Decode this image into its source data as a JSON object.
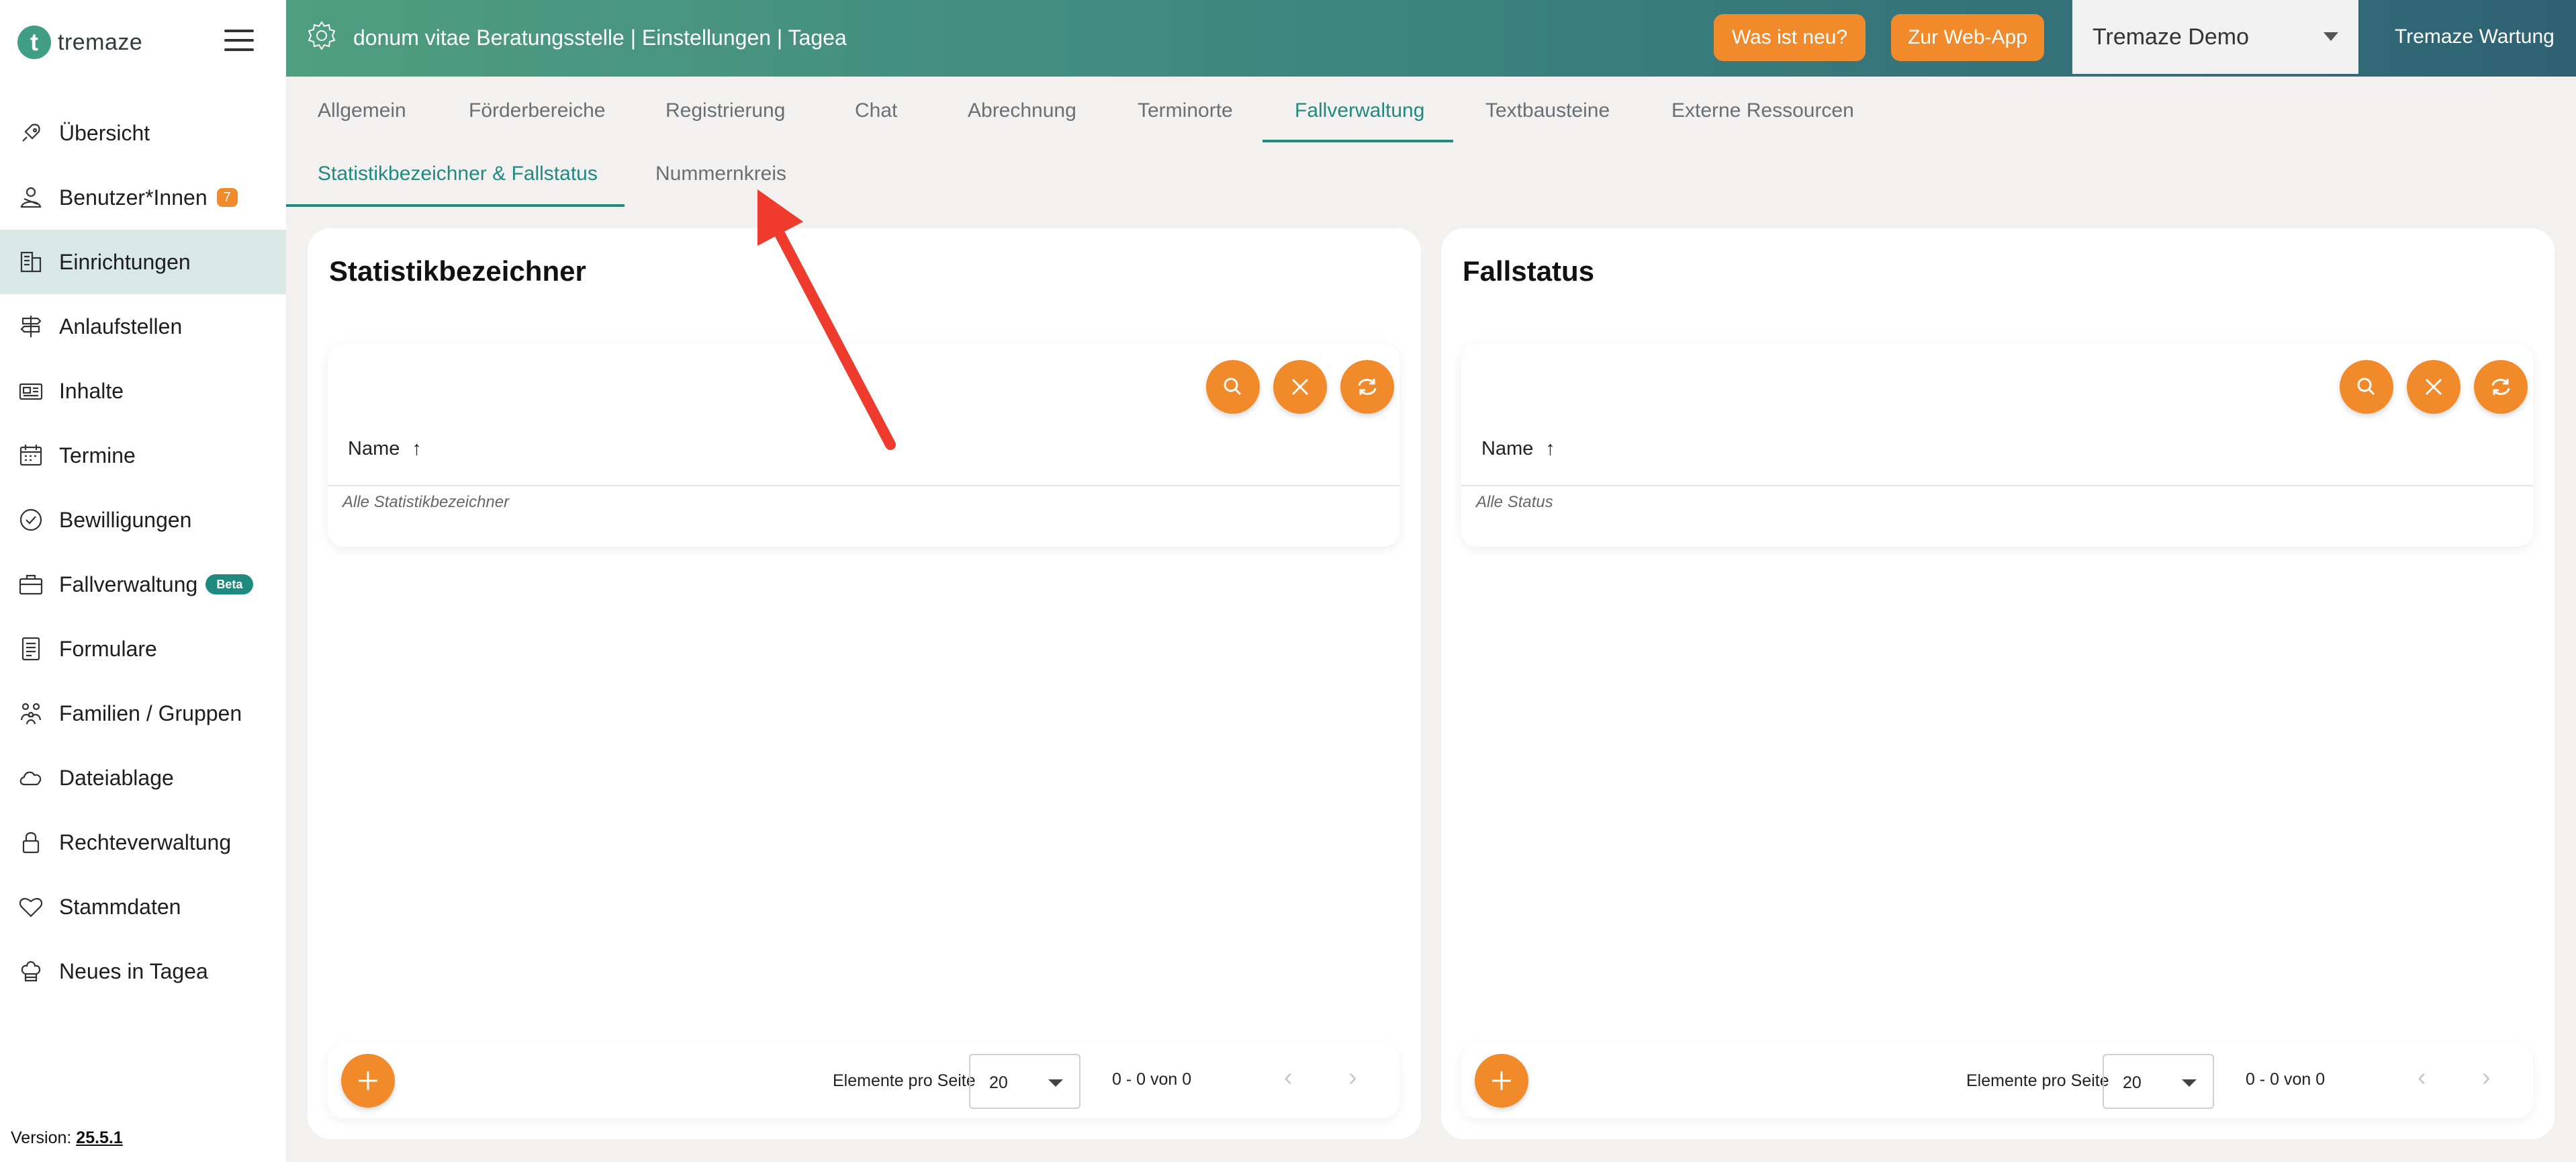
{
  "app": {
    "logo_letter": "t",
    "logo_text": "tremaze",
    "version_label": "Version:",
    "version": "25.5.1"
  },
  "sidebar": {
    "items": [
      {
        "label": "Übersicht",
        "icon": "rocket-icon"
      },
      {
        "label": "Benutzer*Innen",
        "icon": "users-icon",
        "badge": "7"
      },
      {
        "label": "Einrichtungen",
        "icon": "building-icon",
        "active": true
      },
      {
        "label": "Anlaufstellen",
        "icon": "signpost-icon"
      },
      {
        "label": "Inhalte",
        "icon": "content-icon"
      },
      {
        "label": "Termine",
        "icon": "calendar-icon"
      },
      {
        "label": "Bewilligungen",
        "icon": "check-circle-icon"
      },
      {
        "label": "Fallverwaltung",
        "icon": "briefcase-icon",
        "badge": "Beta"
      },
      {
        "label": "Formulare",
        "icon": "form-icon"
      },
      {
        "label": "Familien / Gruppen",
        "icon": "family-icon"
      },
      {
        "label": "Dateiablage",
        "icon": "cloud-icon"
      },
      {
        "label": "Rechteverwaltung",
        "icon": "lock-icon"
      },
      {
        "label": "Stammdaten",
        "icon": "heart-icon"
      },
      {
        "label": "Neues in Tagea",
        "icon": "chef-hat-icon"
      }
    ]
  },
  "header": {
    "title": "donum vitae Beratungsstelle | Einstellungen | Tagea",
    "whats_new": "Was ist neu?",
    "web_app": "Zur Web-App",
    "tenant_select": "Tremaze Demo",
    "maintenance": "Tremaze Wartung"
  },
  "tabs": [
    "Allgemein",
    "Förderbereiche",
    "Registrierung",
    "Chat",
    "Abrechnung",
    "Terminorte",
    "Fallverwaltung",
    "Textbausteine",
    "Externe Ressourcen"
  ],
  "active_tab": "Fallverwaltung",
  "subtabs": [
    "Statistikbezeichner & Fallstatus",
    "Nummernkreis"
  ],
  "active_subtab": "Statistikbezeichner & Fallstatus",
  "cards": {
    "left": {
      "title": "Statistikbezeichner",
      "column": "Name",
      "sort_arrow": "↑",
      "empty": "Alle Statistikbezeichner"
    },
    "right": {
      "title": "Fallstatus",
      "column": "Name",
      "sort_arrow": "↑",
      "empty": "Alle Status"
    }
  },
  "pagination": {
    "per_page_label": "Elemente pro Seite",
    "per_page": "20",
    "range": "0 - 0 von 0",
    "prev": "‹",
    "next": "›"
  },
  "colors": {
    "accent_orange": "#f08a2b",
    "teal": "#1f8a80",
    "arrow_red": "#ef3b2d"
  }
}
